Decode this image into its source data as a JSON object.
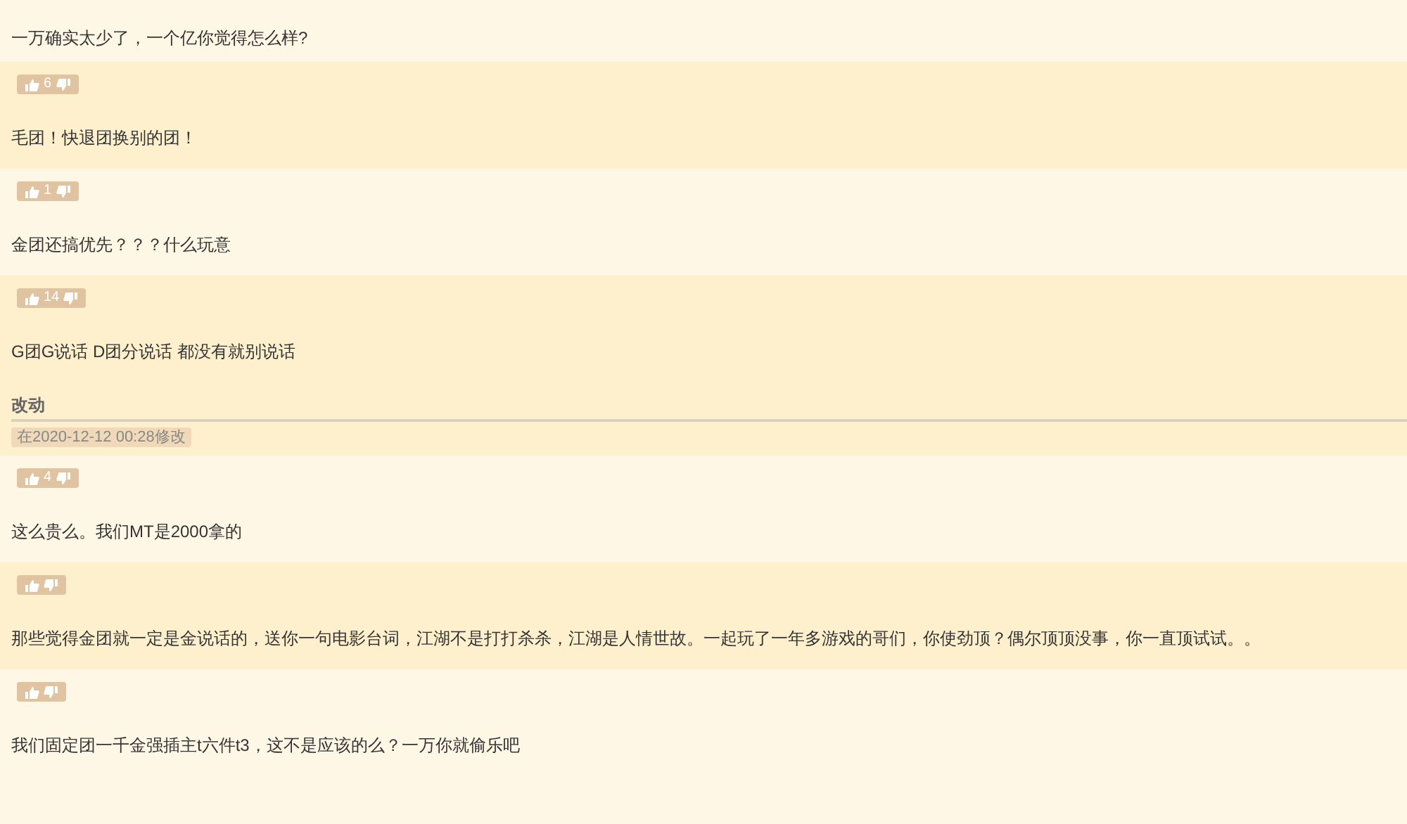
{
  "posts": [
    {
      "vote_bar": false,
      "text": "一万确实太少了，一个亿你觉得怎么样?"
    },
    {
      "vote_bar": true,
      "votes": "6",
      "text": "毛团！快退团换别的团！"
    },
    {
      "vote_bar": true,
      "votes": "1",
      "text": "金团还搞优先？？？什么玩意"
    },
    {
      "vote_bar": true,
      "votes": "14",
      "text": "G团G说话 D团分说话 都没有就别说话",
      "edit": {
        "label": "改动",
        "date": "在2020-12-12 00:28修改"
      }
    },
    {
      "vote_bar": true,
      "votes": "4",
      "text": "这么贵么。我们MT是2000拿的"
    },
    {
      "vote_bar": true,
      "text": "那些觉得金团就一定是金说话的，送你一句电影台词，江湖不是打打杀杀，江湖是人情世故。一起玩了一年多游戏的哥们，你使劲顶？偶尔顶顶没事，你一直顶试试。。"
    },
    {
      "vote_bar": true,
      "text": "我们固定团一千金强插主t六件t3，这不是应该的么？一万你就偷乐吧"
    }
  ]
}
